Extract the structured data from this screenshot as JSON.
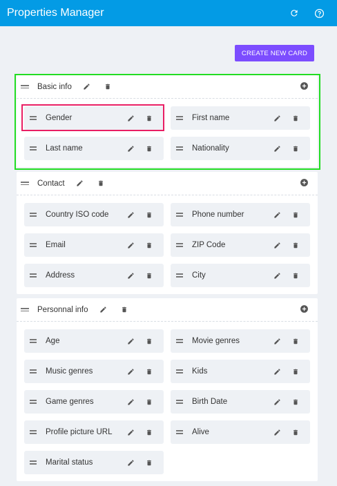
{
  "app": {
    "title": "Properties Manager"
  },
  "toolbar": {
    "refresh_icon": "refresh-icon",
    "help_icon": "help-icon"
  },
  "actions": {
    "create_card_label": "CREATE NEW CARD"
  },
  "cards": [
    {
      "title": "Basic info",
      "fields": [
        "Gender",
        "First name",
        "Last name",
        "Nationality"
      ]
    },
    {
      "title": "Contact",
      "fields": [
        "Country ISO code",
        "Phone number",
        "Email",
        "ZIP Code",
        "Address",
        "City"
      ]
    },
    {
      "title": "Personnal info",
      "fields": [
        "Age",
        "Movie genres",
        "Music genres",
        "Kids",
        "Game genres",
        "Birth Date",
        "Profile picture URL",
        "Alive",
        "Marital status"
      ]
    }
  ],
  "colors": {
    "appbar": "#039be5",
    "create_button": "#7c4dff",
    "highlight_card": "#22dd22",
    "highlight_field": "#e91e63",
    "background": "#eef1f5"
  }
}
